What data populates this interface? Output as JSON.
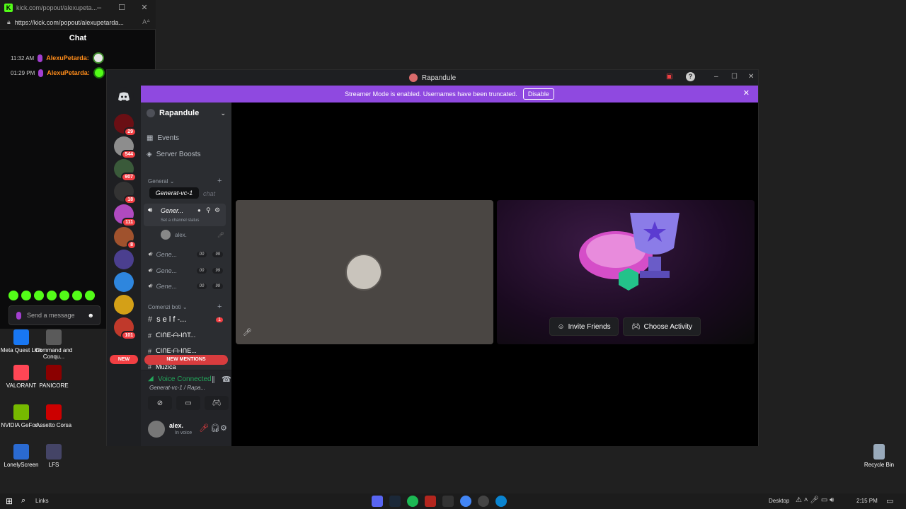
{
  "popout": {
    "tab_title": "kick.com/popout/alexupeta...",
    "url": "https://kick.com/popout/alexupetarda...",
    "chat_title": "Chat",
    "messages": [
      {
        "time": "11:32 AM",
        "user": "AlexuPetarda:"
      },
      {
        "time": "01:29 PM",
        "user": "AlexuPetarda:"
      }
    ],
    "send_placeholder": "Send a message"
  },
  "desktop_icons": [
    {
      "label": "Meta Quest Link",
      "color": "#1877f2"
    },
    {
      "label": "Command and Conqu...",
      "color": "#5a5a5a"
    },
    {
      "label": "VALORANT",
      "color": "#ff4655"
    },
    {
      "label": "PANICORE",
      "color": "#8b0000"
    },
    {
      "label": "NVIDIA GeFor...",
      "color": "#76b900"
    },
    {
      "label": "Assetto Corsa",
      "color": "#c00"
    },
    {
      "label": "LonelyScreen",
      "color": "#2a6ad1"
    },
    {
      "label": "LFS",
      "color": "#446"
    },
    {
      "label": "Recycle Bin",
      "color": "#9ab"
    }
  ],
  "discord": {
    "window_title": "Rapandule",
    "banner_text": "Streamer Mode is enabled. Usernames have been truncated.",
    "banner_button": "Disable",
    "server_name": "Rapandule",
    "menu": [
      "Events",
      "Server Boosts"
    ],
    "server_badges": [
      "29",
      "544",
      "907",
      "18",
      "111",
      "8",
      "101"
    ],
    "category_general": "General",
    "tooltip": "Generat-vc-1",
    "text_channel_faded": "chat",
    "active_voice": "Gener...",
    "channel_status": "Set a channel status",
    "voice_user": "alex.",
    "voice_channels": [
      {
        "name": "Gene...",
        "a": "00",
        "b": "99"
      },
      {
        "name": "Gene...",
        "a": "00",
        "b": "99"
      },
      {
        "name": "Gene...",
        "a": "00",
        "b": "99"
      }
    ],
    "category_bots": "Comenzi boti",
    "bot_channels": [
      {
        "name": "s e l f -...",
        "badge": "1"
      },
      {
        "name": "ᑕIᑎE-ᗩ-IᑎT..."
      },
      {
        "name": "ᑕIᑎE-ᗩ-IᑎE..."
      },
      {
        "name": "Muzica"
      }
    ],
    "new_label": "NEW",
    "new_mentions": "NEW MENTIONS",
    "voice_connected": "Voice Connected",
    "voice_location": "Generat-vc-1 / Rapa...",
    "user_name": "alex.",
    "user_status": "In voice",
    "invite_button": "Invite Friends",
    "activity_button": "Choose Activity"
  },
  "taskbar": {
    "search": "Links",
    "desktop": "Desktop",
    "time": "2:15 PM"
  }
}
